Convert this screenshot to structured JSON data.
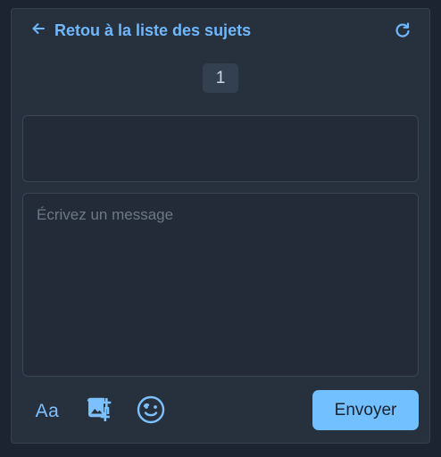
{
  "header": {
    "back_label": "Retou à la liste des sujets",
    "back_icon": "arrow-left-icon",
    "refresh_icon": "refresh-icon"
  },
  "pagination": {
    "current_page": "1"
  },
  "composer": {
    "placeholder": "Écrivez un message",
    "value": "",
    "format_label": "Aa",
    "image_icon": "add-image-icon",
    "emoji_icon": "emoji-icon",
    "send_label": "Envoyer"
  },
  "colors": {
    "accent": "#72c0ff",
    "panel_bg": "#27313e",
    "page_bg": "#1b2430"
  }
}
